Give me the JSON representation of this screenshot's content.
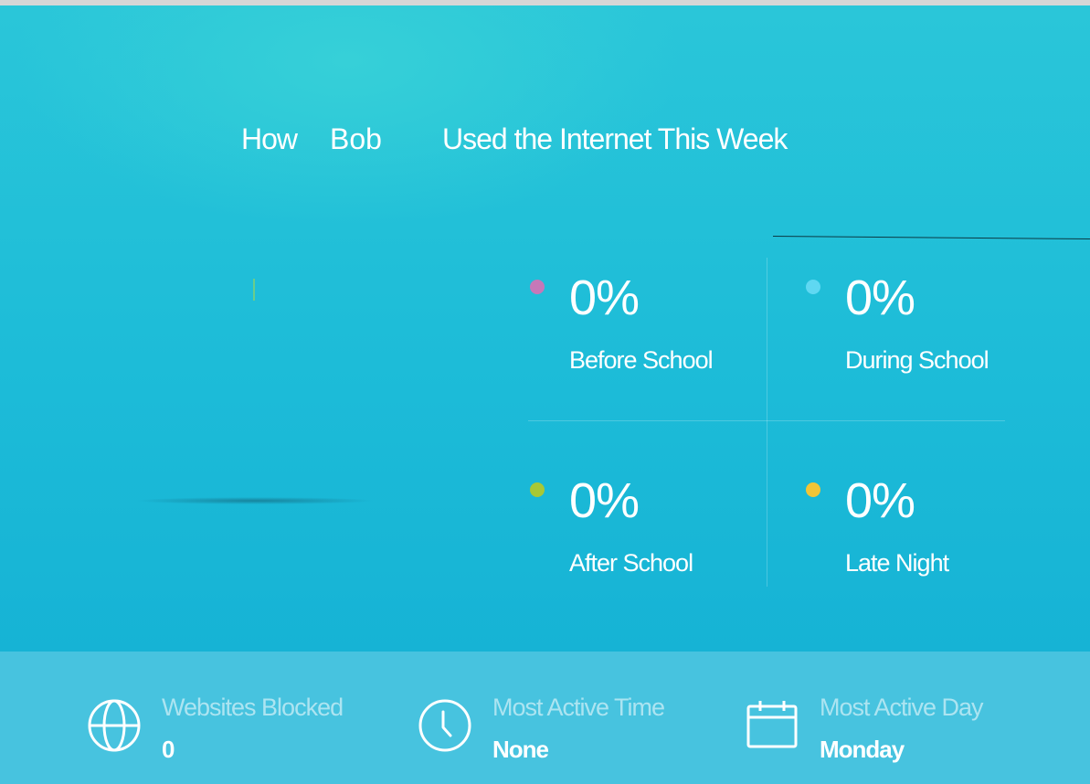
{
  "title": {
    "prefix": "How",
    "name": "Bob",
    "suffix": "Used the Internet This Week"
  },
  "stats": [
    {
      "percent": "0%",
      "label": "Before School",
      "color": "#c678b8"
    },
    {
      "percent": "0%",
      "label": "During School",
      "color": "#5fd8f2"
    },
    {
      "percent": "0%",
      "label": "After School",
      "color": "#a8c835"
    },
    {
      "percent": "0%",
      "label": "Late Night",
      "color": "#f2c536"
    }
  ],
  "footer": {
    "websites_blocked": {
      "title": "Websites Blocked",
      "value": "0",
      "icon": "globe-icon"
    },
    "most_active_time": {
      "title": "Most Active Time",
      "value": "None",
      "icon": "clock-icon"
    },
    "most_active_day": {
      "title": "Most Active Day",
      "value": "Monday",
      "icon": "calendar-icon"
    }
  },
  "colors": {
    "background": "#18b7d5",
    "footer_background": "#47c3df"
  }
}
